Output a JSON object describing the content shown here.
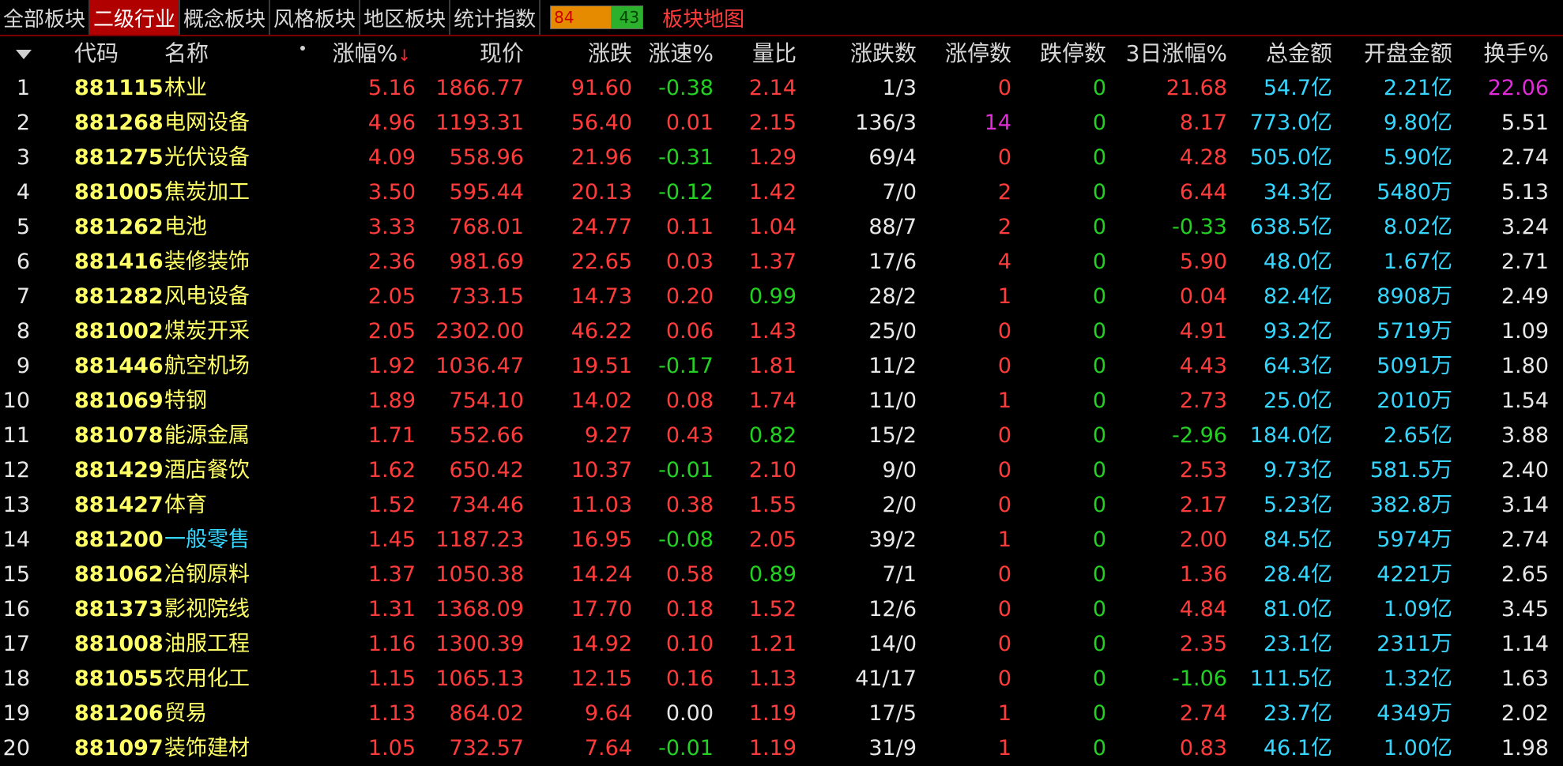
{
  "tabs": [
    {
      "label": "全部板块",
      "active": false
    },
    {
      "label": "二级行业",
      "active": true
    },
    {
      "label": "概念板块",
      "active": false
    },
    {
      "label": "风格板块",
      "active": false
    },
    {
      "label": "地区板块",
      "active": false
    },
    {
      "label": "统计指数",
      "active": false
    }
  ],
  "updown": {
    "up": "84",
    "down": "43"
  },
  "map_link": "板块地图",
  "headers": {
    "code": "代码",
    "name": "名称",
    "pct": "涨幅%",
    "price": "现价",
    "change": "涨跌",
    "speed": "涨速%",
    "vol_ratio": "量比",
    "up_down_count": "涨跌数",
    "limit_up": "涨停数",
    "limit_down": "跌停数",
    "pct3d": "3日涨幅%",
    "amount": "总金额",
    "open_amount": "开盘金额",
    "turnover": "换手%"
  },
  "sort_indicator": "↓",
  "rows": [
    {
      "idx": "1",
      "code": "881115",
      "name": "林业",
      "pct": "5.16",
      "price": "1866.77",
      "change": "91.60",
      "speed": "-0.38",
      "vol_ratio": "2.14",
      "ud": "1/3",
      "lu": "0",
      "ld": "0",
      "pct3d": "21.68",
      "amount": "54.7亿",
      "open": "2.21亿",
      "turnover": "22.06"
    },
    {
      "idx": "2",
      "code": "881268",
      "name": "电网设备",
      "pct": "4.96",
      "price": "1193.31",
      "change": "56.40",
      "speed": "0.01",
      "vol_ratio": "2.15",
      "ud": "136/3",
      "lu": "14",
      "ld": "0",
      "pct3d": "8.17",
      "amount": "773.0亿",
      "open": "9.80亿",
      "turnover": "5.51"
    },
    {
      "idx": "3",
      "code": "881275",
      "name": "光伏设备",
      "pct": "4.09",
      "price": "558.96",
      "change": "21.96",
      "speed": "-0.31",
      "vol_ratio": "1.29",
      "ud": "69/4",
      "lu": "0",
      "ld": "0",
      "pct3d": "4.28",
      "amount": "505.0亿",
      "open": "5.90亿",
      "turnover": "2.74"
    },
    {
      "idx": "4",
      "code": "881005",
      "name": "焦炭加工",
      "pct": "3.50",
      "price": "595.44",
      "change": "20.13",
      "speed": "-0.12",
      "vol_ratio": "1.42",
      "ud": "7/0",
      "lu": "2",
      "ld": "0",
      "pct3d": "6.44",
      "amount": "34.3亿",
      "open": "5480万",
      "turnover": "5.13"
    },
    {
      "idx": "5",
      "code": "881262",
      "name": "电池",
      "pct": "3.33",
      "price": "768.01",
      "change": "24.77",
      "speed": "0.11",
      "vol_ratio": "1.04",
      "ud": "88/7",
      "lu": "2",
      "ld": "0",
      "pct3d": "-0.33",
      "amount": "638.5亿",
      "open": "8.02亿",
      "turnover": "3.24"
    },
    {
      "idx": "6",
      "code": "881416",
      "name": "装修装饰",
      "pct": "2.36",
      "price": "981.69",
      "change": "22.65",
      "speed": "0.03",
      "vol_ratio": "1.37",
      "ud": "17/6",
      "lu": "4",
      "ld": "0",
      "pct3d": "5.90",
      "amount": "48.0亿",
      "open": "1.67亿",
      "turnover": "2.71"
    },
    {
      "idx": "7",
      "code": "881282",
      "name": "风电设备",
      "pct": "2.05",
      "price": "733.15",
      "change": "14.73",
      "speed": "0.20",
      "vol_ratio": "0.99",
      "ud": "28/2",
      "lu": "1",
      "ld": "0",
      "pct3d": "0.04",
      "amount": "82.4亿",
      "open": "8908万",
      "turnover": "2.49"
    },
    {
      "idx": "8",
      "code": "881002",
      "name": "煤炭开采",
      "pct": "2.05",
      "price": "2302.00",
      "change": "46.22",
      "speed": "0.06",
      "vol_ratio": "1.43",
      "ud": "25/0",
      "lu": "0",
      "ld": "0",
      "pct3d": "4.91",
      "amount": "93.2亿",
      "open": "5719万",
      "turnover": "1.09"
    },
    {
      "idx": "9",
      "code": "881446",
      "name": "航空机场",
      "pct": "1.92",
      "price": "1036.47",
      "change": "19.51",
      "speed": "-0.17",
      "vol_ratio": "1.81",
      "ud": "11/2",
      "lu": "0",
      "ld": "0",
      "pct3d": "4.43",
      "amount": "64.3亿",
      "open": "5091万",
      "turnover": "1.80"
    },
    {
      "idx": "10",
      "code": "881069",
      "name": "特钢",
      "pct": "1.89",
      "price": "754.10",
      "change": "14.02",
      "speed": "0.08",
      "vol_ratio": "1.74",
      "ud": "11/0",
      "lu": "1",
      "ld": "0",
      "pct3d": "2.73",
      "amount": "25.0亿",
      "open": "2010万",
      "turnover": "1.54"
    },
    {
      "idx": "11",
      "code": "881078",
      "name": "能源金属",
      "pct": "1.71",
      "price": "552.66",
      "change": "9.27",
      "speed": "0.43",
      "vol_ratio": "0.82",
      "ud": "15/2",
      "lu": "0",
      "ld": "0",
      "pct3d": "-2.96",
      "amount": "184.0亿",
      "open": "2.65亿",
      "turnover": "3.88"
    },
    {
      "idx": "12",
      "code": "881429",
      "name": "酒店餐饮",
      "pct": "1.62",
      "price": "650.42",
      "change": "10.37",
      "speed": "-0.01",
      "vol_ratio": "2.10",
      "ud": "9/0",
      "lu": "0",
      "ld": "0",
      "pct3d": "2.53",
      "amount": "9.73亿",
      "open": "581.5万",
      "turnover": "2.40"
    },
    {
      "idx": "13",
      "code": "881427",
      "name": "体育",
      "pct": "1.52",
      "price": "734.46",
      "change": "11.03",
      "speed": "0.38",
      "vol_ratio": "1.55",
      "ud": "2/0",
      "lu": "0",
      "ld": "0",
      "pct3d": "2.17",
      "amount": "5.23亿",
      "open": "382.8万",
      "turnover": "3.14"
    },
    {
      "idx": "14",
      "code": "881200",
      "name": "一般零售",
      "pct": "1.45",
      "price": "1187.23",
      "change": "16.95",
      "speed": "-0.08",
      "vol_ratio": "2.05",
      "ud": "39/2",
      "lu": "1",
      "ld": "0",
      "pct3d": "2.00",
      "amount": "84.5亿",
      "open": "5974万",
      "turnover": "2.74"
    },
    {
      "idx": "15",
      "code": "881062",
      "name": "冶钢原料",
      "pct": "1.37",
      "price": "1050.38",
      "change": "14.24",
      "speed": "0.58",
      "vol_ratio": "0.89",
      "ud": "7/1",
      "lu": "0",
      "ld": "0",
      "pct3d": "1.36",
      "amount": "28.4亿",
      "open": "4221万",
      "turnover": "2.65"
    },
    {
      "idx": "16",
      "code": "881373",
      "name": "影视院线",
      "pct": "1.31",
      "price": "1368.09",
      "change": "17.70",
      "speed": "0.18",
      "vol_ratio": "1.52",
      "ud": "12/6",
      "lu": "0",
      "ld": "0",
      "pct3d": "4.84",
      "amount": "81.0亿",
      "open": "1.09亿",
      "turnover": "3.45"
    },
    {
      "idx": "17",
      "code": "881008",
      "name": "油服工程",
      "pct": "1.16",
      "price": "1300.39",
      "change": "14.92",
      "speed": "0.10",
      "vol_ratio": "1.21",
      "ud": "14/0",
      "lu": "0",
      "ld": "0",
      "pct3d": "2.35",
      "amount": "23.1亿",
      "open": "2311万",
      "turnover": "1.14"
    },
    {
      "idx": "18",
      "code": "881055",
      "name": "农用化工",
      "pct": "1.15",
      "price": "1065.13",
      "change": "12.15",
      "speed": "0.16",
      "vol_ratio": "1.13",
      "ud": "41/17",
      "lu": "0",
      "ld": "0",
      "pct3d": "-1.06",
      "amount": "111.5亿",
      "open": "1.32亿",
      "turnover": "1.63"
    },
    {
      "idx": "19",
      "code": "881206",
      "name": "贸易",
      "pct": "1.13",
      "price": "864.02",
      "change": "9.64",
      "speed": "0.00",
      "vol_ratio": "1.19",
      "ud": "17/5",
      "lu": "1",
      "ld": "0",
      "pct3d": "2.74",
      "amount": "23.7亿",
      "open": "4349万",
      "turnover": "2.02"
    },
    {
      "idx": "20",
      "code": "881097",
      "name": "装饰建材",
      "pct": "1.05",
      "price": "732.57",
      "change": "7.64",
      "speed": "-0.01",
      "vol_ratio": "1.19",
      "ud": "31/9",
      "lu": "1",
      "ld": "0",
      "pct3d": "0.83",
      "amount": "46.1亿",
      "open": "1.00亿",
      "turnover": "1.98"
    }
  ],
  "colors": {
    "up": "#ff3b3b",
    "down": "#23d123",
    "flat": "#e8e8e8",
    "amount": "#35d6ff",
    "code": "#ffff66",
    "highlight_name": "#35d6ff",
    "magenta": "#e12bd8"
  }
}
